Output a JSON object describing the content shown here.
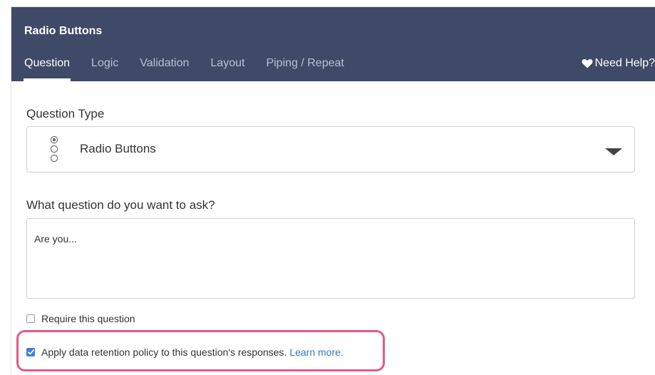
{
  "header": {
    "title": "Radio Buttons",
    "tabs": [
      {
        "label": "Question",
        "active": true
      },
      {
        "label": "Logic",
        "active": false
      },
      {
        "label": "Validation",
        "active": false
      },
      {
        "label": "Layout",
        "active": false
      },
      {
        "label": "Piping / Repeat",
        "active": false
      }
    ],
    "help_label": "Need Help?",
    "help_icon": "heart-icon",
    "background": "#3f4a68"
  },
  "question_type": {
    "label": "Question Type",
    "selected": "Radio Buttons",
    "icon": "radio-buttons-icon"
  },
  "question_text": {
    "label": "What question do you want to ask?",
    "value": "Are you..."
  },
  "options": {
    "require": {
      "label": "Require this question",
      "checked": false
    },
    "retention": {
      "label": "Apply data retention policy to this question's responses.",
      "checked": true,
      "link": "Learn more."
    }
  },
  "colors": {
    "highlight": "#e35a86",
    "link": "#2f79c6",
    "checkbox": "#3d7fd9"
  }
}
